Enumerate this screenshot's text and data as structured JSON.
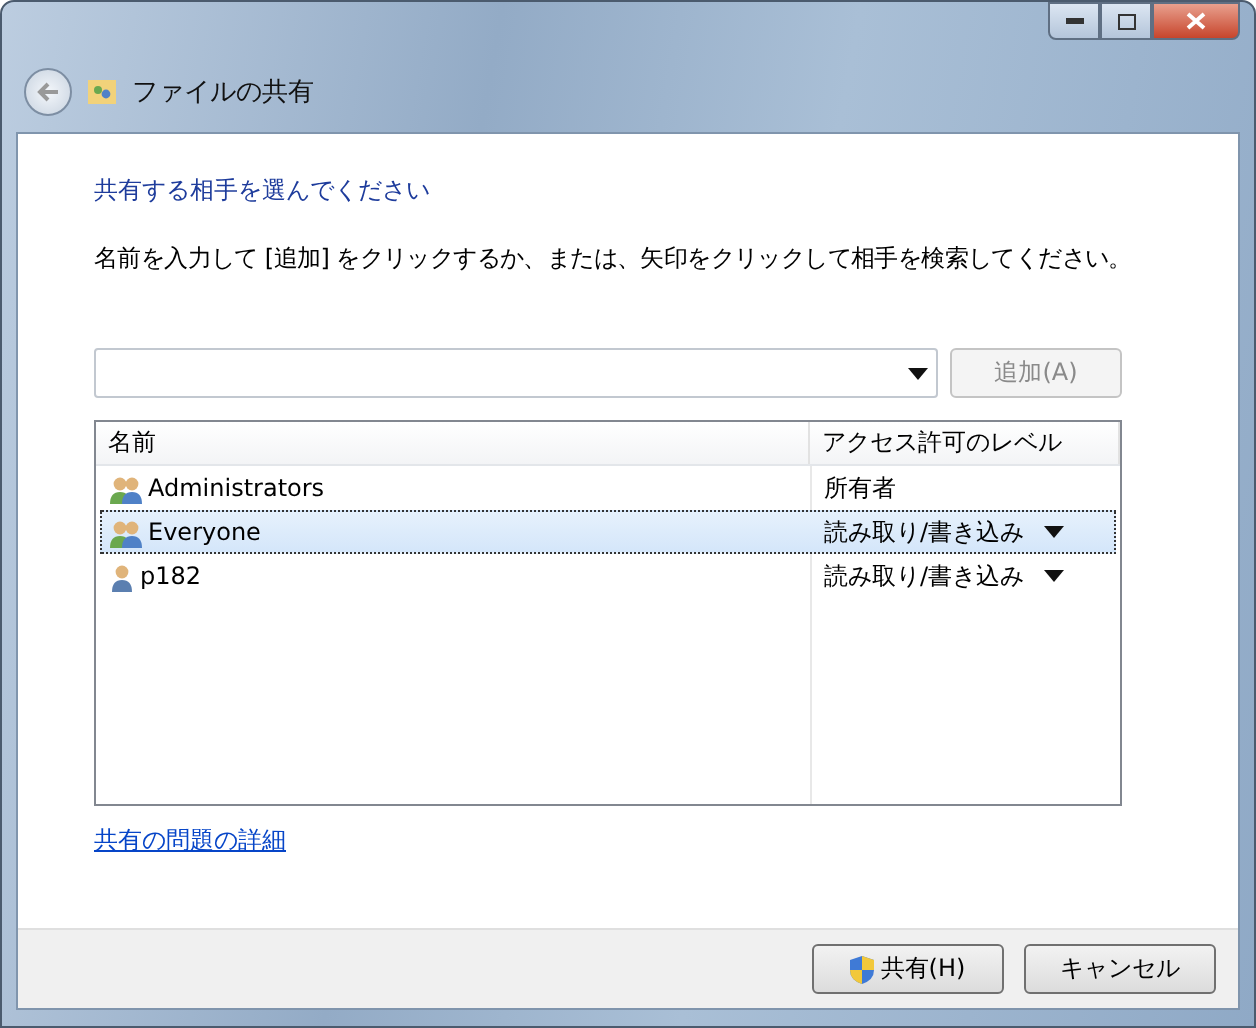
{
  "window": {
    "title": "ファイルの共有"
  },
  "heading": "共有する相手を選んでください",
  "instruction": "名前を入力して [追加] をクリックするか、または、矢印をクリックして相手を検索してください。",
  "add_button": {
    "label": "追加(A)",
    "disabled": true
  },
  "table": {
    "columns": [
      "名前",
      "アクセス許可のレベル"
    ],
    "rows": [
      {
        "kind": "group",
        "name": "Administrators",
        "level": "所有者",
        "menu": false,
        "selected": false
      },
      {
        "kind": "group",
        "name": "Everyone",
        "level": "読み取り/書き込み",
        "menu": true,
        "selected": true
      },
      {
        "kind": "user",
        "name": "p182",
        "level": "読み取り/書き込み",
        "menu": true,
        "selected": false
      }
    ]
  },
  "help_link": "共有の問題の詳細",
  "buttons": [
    {
      "kind": "shield",
      "label": "共有(H)"
    },
    {
      "kind": "plain",
      "label": "キャンセル"
    }
  ]
}
